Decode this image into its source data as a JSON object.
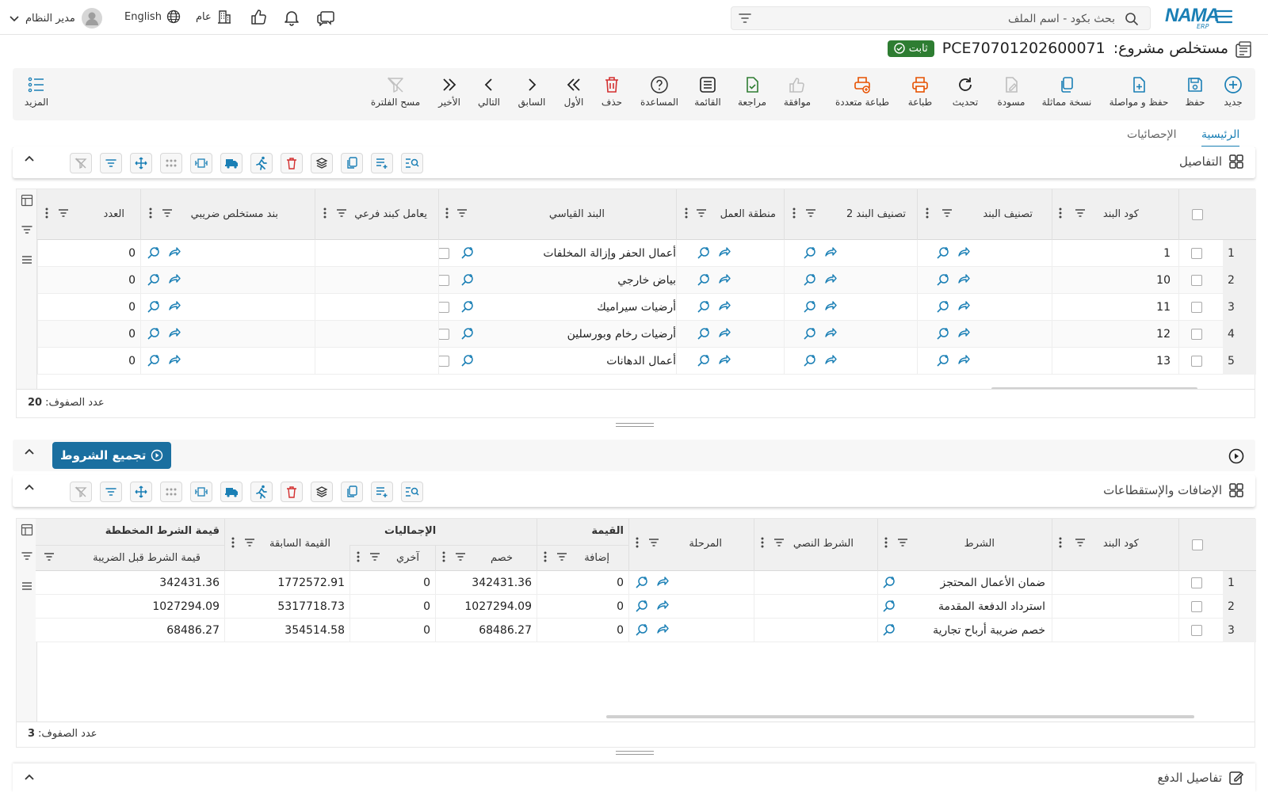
{
  "topbar": {
    "logo_text": "NAMA",
    "logo_sub": "ERP",
    "search_placeholder": "بحث بكود - اسم الملف",
    "user": "مدير النظام",
    "language": "English",
    "scope": "عام"
  },
  "title": {
    "label": "مستخلص مشروع:",
    "code": "PCE70701202600071",
    "status": "ثابت"
  },
  "toolbar": {
    "new": "جديد",
    "save": "حفظ",
    "save_continue": "حفظ و مواصلة",
    "duplicate": "نسخة مماثلة",
    "draft": "مسودة",
    "refresh": "تحديث",
    "print": "طباعة",
    "multi_print": "طباعة متعددة",
    "approve": "موافقة",
    "review": "مراجعة",
    "list": "القائمة",
    "help": "المساعدة",
    "delete": "حذف",
    "first": "الأول",
    "previous": "السابق",
    "next": "التالي",
    "last": "الأخير",
    "clear_filter": "مسح الفلترة",
    "more": "المزيد"
  },
  "tabs": {
    "main": "الرئيسية",
    "stats": "الإحصائيات"
  },
  "details": {
    "title": "التفاصيل",
    "columns": {
      "item_code": "كود البند",
      "item_class": "تصنيف البند",
      "item_class2": "تصنيف البند 2",
      "work_area": "منطقة العمل",
      "standard_item": "البند القياسي",
      "sub_item": "يعامل كبند فرعي",
      "tax_item": "بند مستخلص ضريبي",
      "count": "العدد"
    },
    "rows": [
      {
        "n": "1",
        "code": "1",
        "standard": "أعمال الحفر وإزالة المخلفات",
        "count": "0"
      },
      {
        "n": "2",
        "code": "10",
        "standard": "بياض خارجي",
        "count": "0"
      },
      {
        "n": "3",
        "code": "11",
        "standard": "أرضيات سيراميك",
        "count": "0"
      },
      {
        "n": "4",
        "code": "12",
        "standard": "أرضيات رخام وبورسلين",
        "count": "0"
      },
      {
        "n": "5",
        "code": "13",
        "standard": "أعمال الدهانات",
        "count": "0"
      }
    ],
    "row_count_label": "عدد الصفوف:",
    "row_count": "20"
  },
  "conditions_button": "تجميع الشروط",
  "additions": {
    "title": "الإضافات والإستقطاعات",
    "columns": {
      "item_code": "كود البند",
      "condition": "الشرط",
      "text_condition": "الشرط النصي",
      "stage": "المرحلة",
      "value_group": "القيمة",
      "addition": "إضافة",
      "totals_group": "الإجماليات",
      "discount": "خصم",
      "other": "آخري",
      "previous_value": "القيمة السابقة",
      "planned_group": "قيمة الشرط المخططة",
      "before_tax": "قيمة الشرط قبل الضريبة"
    },
    "rows": [
      {
        "n": "1",
        "condition": "ضمان الأعمال المحتجز",
        "addition": "0",
        "discount": "342431.36",
        "other": "0",
        "previous": "1772572.91",
        "before_tax": "342431.36"
      },
      {
        "n": "2",
        "condition": "استرداد الدفعة المقدمة",
        "addition": "0",
        "discount": "1027294.09",
        "other": "0",
        "previous": "5317718.73",
        "before_tax": "1027294.09"
      },
      {
        "n": "3",
        "condition": "خصم ضريبة أرباح تجارية",
        "addition": "0",
        "discount": "68486.27",
        "other": "0",
        "previous": "354514.58",
        "before_tax": "68486.27"
      }
    ],
    "row_count_label": "عدد الصفوف:",
    "row_count": "3"
  },
  "payment": {
    "title": "تفاصيل الدفع"
  },
  "colors": {
    "accent": "#1a7fb5",
    "green": "#2e7d32",
    "orange": "#e65100",
    "red": "#d32f2f"
  }
}
